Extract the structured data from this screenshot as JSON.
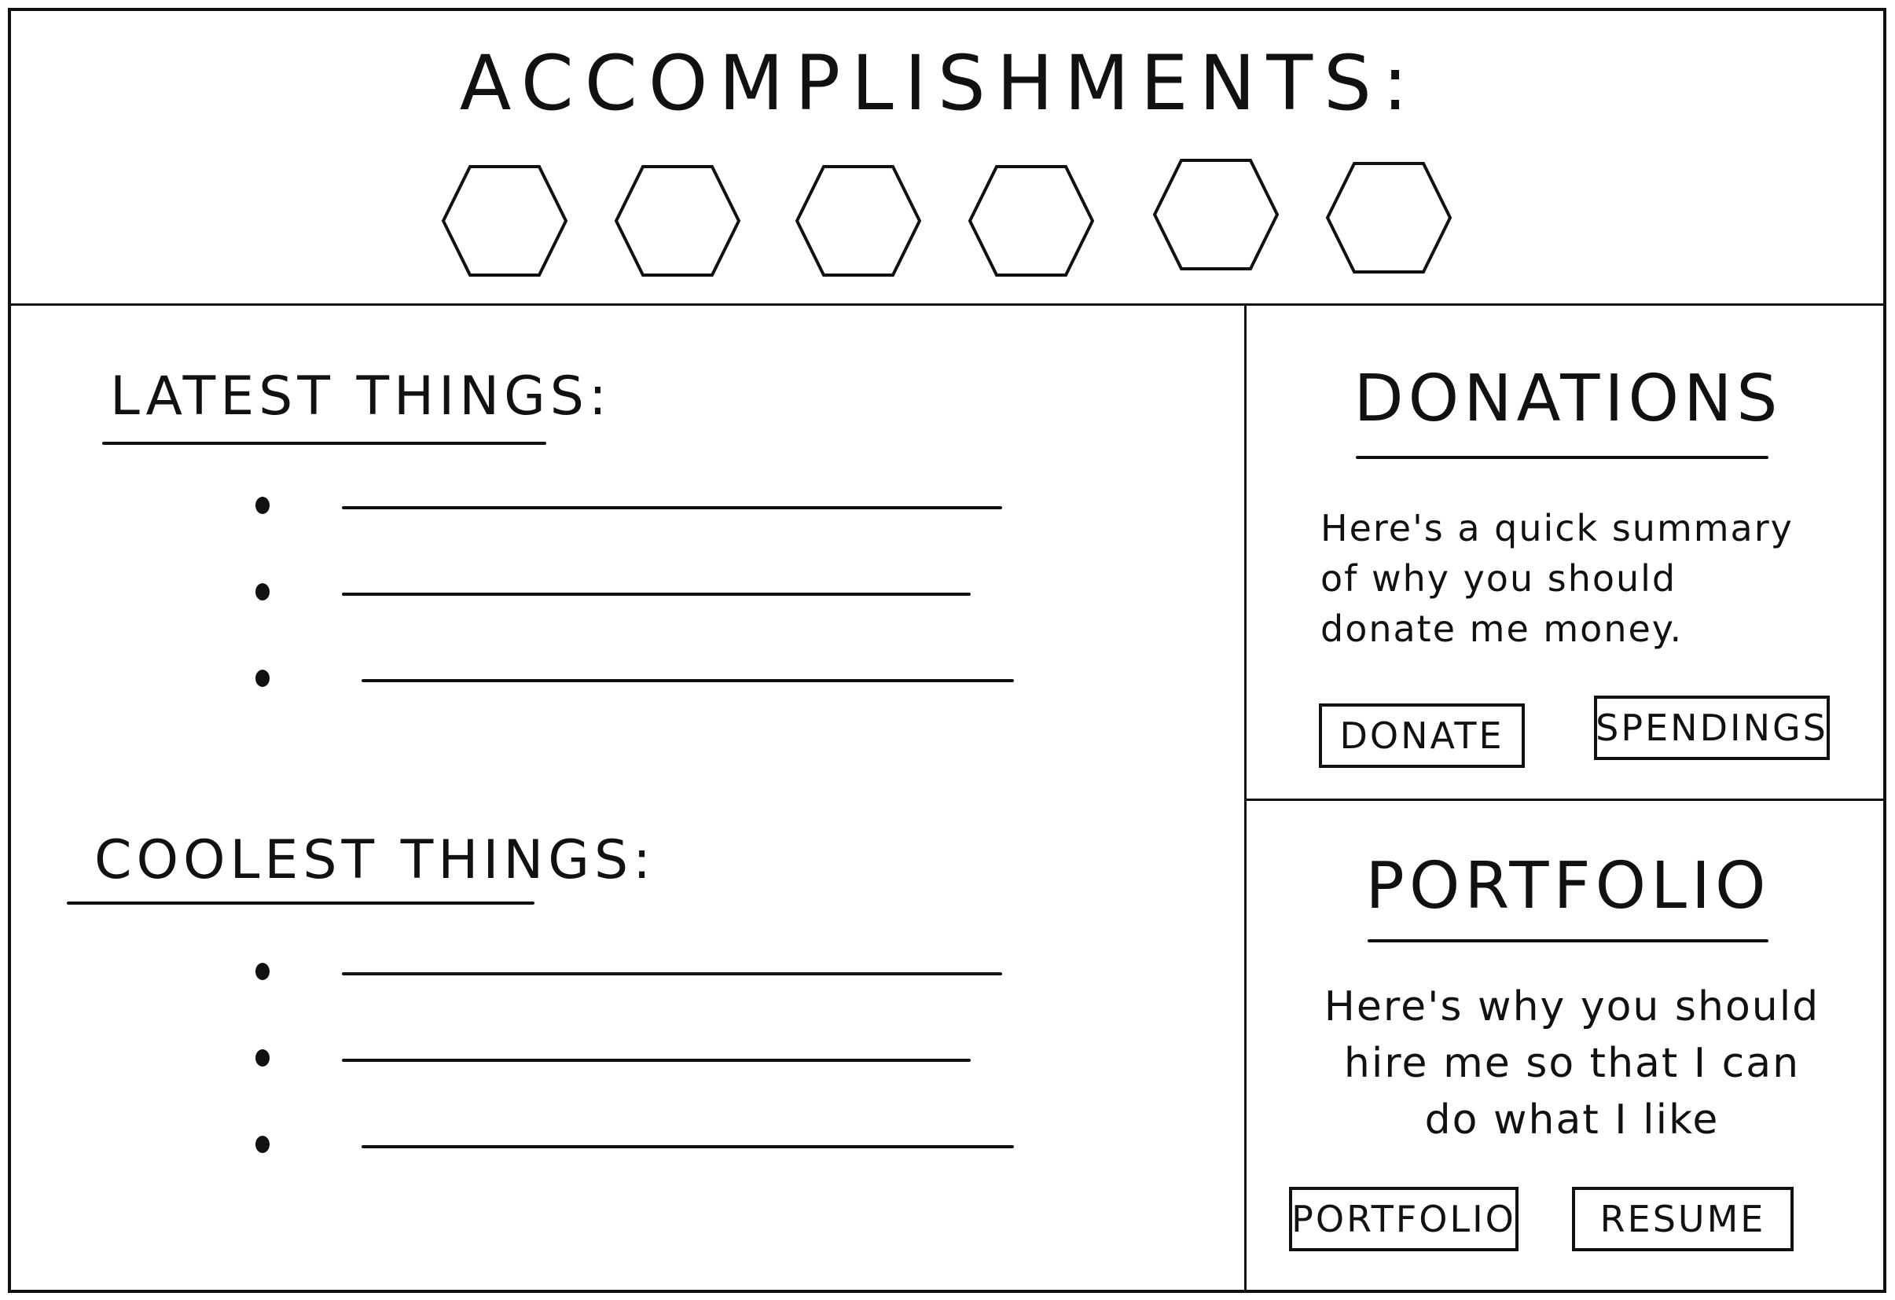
{
  "header": {
    "title": "ACCOMPLISHMENTS:",
    "badges": [
      {
        "icon": "hexagon-badge-icon"
      },
      {
        "icon": "hexagon-badge-icon"
      },
      {
        "icon": "hexagon-badge-icon"
      },
      {
        "icon": "hexagon-badge-icon"
      },
      {
        "icon": "hexagon-badge-icon"
      },
      {
        "icon": "hexagon-badge-icon"
      }
    ]
  },
  "latest": {
    "title": "LATEST THINGS:",
    "items": [
      {
        "icon": "bullet-icon"
      },
      {
        "icon": "bullet-icon"
      },
      {
        "icon": "bullet-icon"
      }
    ]
  },
  "coolest": {
    "title": "COOLEST THINGS:",
    "items": [
      {
        "icon": "bullet-icon"
      },
      {
        "icon": "bullet-icon"
      },
      {
        "icon": "bullet-icon"
      }
    ]
  },
  "donations": {
    "title": "DONATIONS",
    "text": "Here's a quick summary of why you should donate me money.",
    "donate_label": "DONATE",
    "spendings_label": "SPENDINGS"
  },
  "portfolio": {
    "title": "PORTFOLIO",
    "text": "Here's why you should hire me so that I can do what I like",
    "portfolio_label": "PORTFOLIO",
    "resume_label": "RESUME"
  },
  "colors": {
    "ink": "#111111",
    "paper": "#ffffff"
  }
}
